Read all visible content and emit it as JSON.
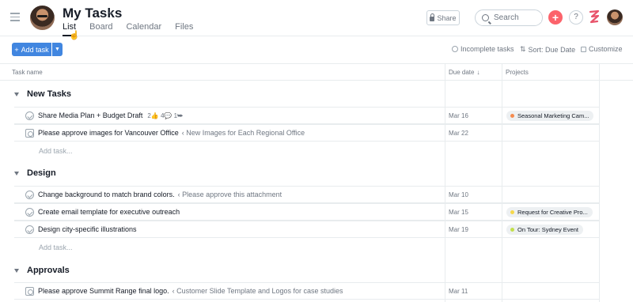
{
  "header": {
    "title": "My Tasks",
    "tabs": [
      {
        "label": "List",
        "active": true
      },
      {
        "label": "Board",
        "active": false
      },
      {
        "label": "Calendar",
        "active": false
      },
      {
        "label": "Files",
        "active": false
      }
    ],
    "share_label": "Share",
    "search_placeholder": "Search",
    "help_label": "?",
    "plus_label": "+"
  },
  "toolbar": {
    "add_task_label": "Add task",
    "incomplete_label": "Incomplete tasks",
    "sort_label": "Sort: Due Date",
    "customize_label": "Customize"
  },
  "columns": {
    "task_name": "Task name",
    "due_date": "Due date",
    "projects": "Projects"
  },
  "add_task_link": "Add task...",
  "sections": [
    {
      "name": "New Tasks",
      "tasks": [
        {
          "icon": "check-circle-icon",
          "name": "Share Media Plan + Budget Draft",
          "meta": "2👍 4💬 1⮩",
          "parent": "",
          "due": "Mar 16",
          "project": "Seasonal Marketing Cam...",
          "project_color": "#f58b4f"
        },
        {
          "icon": "approval-icon",
          "name": "Please approve images for Vancouver Office",
          "meta": "",
          "parent": "‹ New Images for Each Regional Office",
          "due": "Mar 22",
          "project": "",
          "project_color": ""
        }
      ]
    },
    {
      "name": "Design",
      "tasks": [
        {
          "icon": "check-circle-icon",
          "name": "Change background to match brand colors.",
          "meta": "",
          "parent": "‹ Please approve this attachment",
          "due": "Mar 10",
          "project": "",
          "project_color": ""
        },
        {
          "icon": "check-circle-icon",
          "name": "Create email template for executive outreach",
          "meta": "",
          "parent": "",
          "due": "Mar 15",
          "project": "Request for Creative Pro...",
          "project_color": "#f6d84b"
        },
        {
          "icon": "check-circle-icon",
          "name": "Design city-specific illustrations",
          "meta": "",
          "parent": "",
          "due": "Mar 19",
          "project": "On Tour: Sydney Event",
          "project_color": "#c3e04c"
        }
      ]
    },
    {
      "name": "Approvals",
      "tasks": [
        {
          "icon": "approval-icon",
          "name": "Please approve Summit Range final logo.",
          "meta": "",
          "parent": "‹ Customer Slide Template and Logos for case studies",
          "due": "Mar 11",
          "project": "",
          "project_color": ""
        }
      ]
    }
  ]
}
